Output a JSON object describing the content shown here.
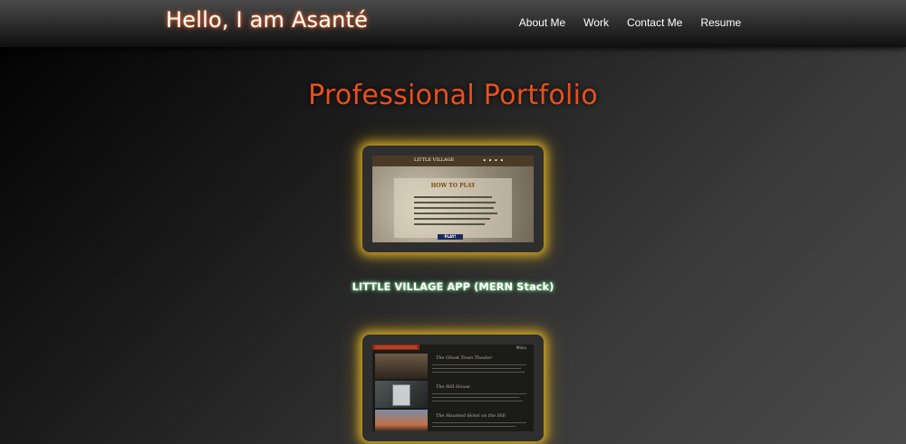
{
  "header": {
    "brand": "Hello, I am Asanté",
    "nav": [
      "About Me",
      "Work",
      "Contact Me",
      "Resume"
    ]
  },
  "main": {
    "title": "Professional Portfolio",
    "projects": [
      {
        "caption": "LITTLE VILLAGE APP (MERN Stack)",
        "thumb": {
          "logo": "LITTLE VILLAGE",
          "heading": "HOW TO PLAY",
          "button": "PLAY!"
        }
      },
      {
        "caption": "",
        "thumb": {
          "menu": "Menu",
          "headings": [
            "The Ghost Town Theater",
            "The Hill House",
            "The Haunted Hotel on the Hill"
          ]
        }
      }
    ]
  },
  "colors": {
    "brand_glow": "#ff6a2b",
    "title": "#e8501e",
    "card_glow": "#ebbe28",
    "caption_glow": "#5bc06c"
  }
}
